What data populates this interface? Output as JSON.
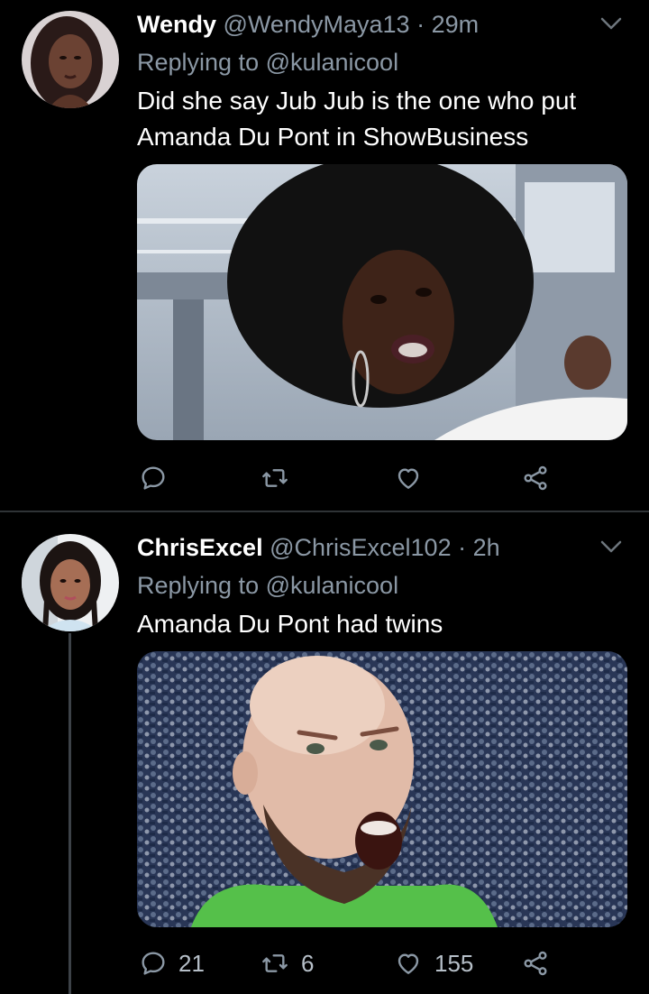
{
  "tweets": [
    {
      "name": "Wendy",
      "handle": "@WendyMaya13",
      "separator": "·",
      "time": "29m",
      "reply_label": "Replying to @kulanicool",
      "text": "Did she say Jub Jub is the one who put Amanda Du Pont in ShowBusiness",
      "actions": {
        "reply": "",
        "retweet": "",
        "like": ""
      }
    },
    {
      "name": "ChrisExcel",
      "handle": "@ChrisExcel102",
      "separator": "·",
      "time": "2h",
      "reply_label": "Replying to @kulanicool",
      "text": "Amanda Du Pont had twins",
      "actions": {
        "reply": "21",
        "retweet": "6",
        "like": "155"
      }
    }
  ],
  "colors": {
    "background": "#000000",
    "secondary_text": "#8b98a5",
    "divider": "#2f3336"
  },
  "icons": [
    "reply-icon",
    "retweet-icon",
    "like-icon",
    "share-icon",
    "chevron-down-icon"
  ]
}
